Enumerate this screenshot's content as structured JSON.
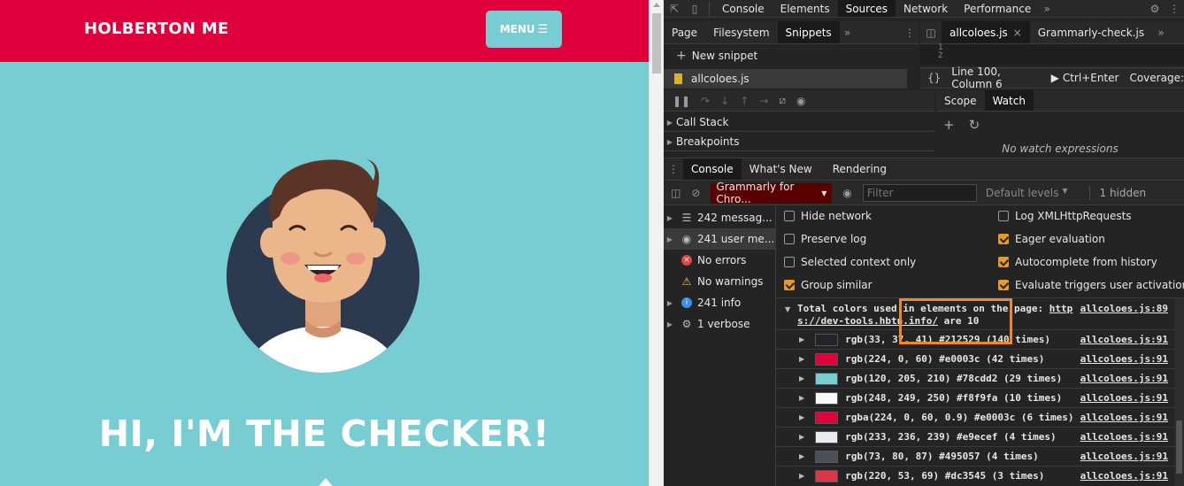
{
  "site": {
    "brand": "HOLBERTON ME",
    "menu_label": "MENU",
    "hero_text": "HI, I'M THE CHECKER!",
    "colors": {
      "primary": "#e0003c",
      "teal": "#78cdd2",
      "navy": "#2b3a4e"
    }
  },
  "devtools": {
    "main_tabs": [
      "Console",
      "Elements",
      "Sources",
      "Network",
      "Performance"
    ],
    "active_main_tab": "Sources",
    "nav_tabs": [
      "Page",
      "Filesystem",
      "Snippets"
    ],
    "new_snippet": "New snippet",
    "snippet_file": "allcoloes.js",
    "editor_tabs": [
      "allcoloes.js",
      "Grammarly-check.js"
    ],
    "line_numbers": [
      "1",
      "2"
    ],
    "status": {
      "position": "Line 100, Column 6",
      "run": "Ctrl+Enter",
      "coverage": "Coverage:"
    },
    "debug_sections": [
      "Call Stack",
      "Breakpoints"
    ],
    "scope_tabs": [
      "Scope",
      "Watch"
    ],
    "no_watch": "No watch expressions",
    "drawer_tabs": [
      "Console",
      "What's New",
      "Rendering"
    ],
    "context": "Grammarly for Chro...",
    "filter_placeholder": "Filter",
    "levels": "Default levels",
    "hidden": "1 hidden",
    "sidebar": [
      {
        "icon": "list-icon",
        "label": "242 messag..."
      },
      {
        "icon": "user-icon",
        "label": "241 user me..."
      },
      {
        "icon": "error-icon",
        "label": "No errors"
      },
      {
        "icon": "warning-icon",
        "label": "No warnings"
      },
      {
        "icon": "info-icon",
        "label": "241 info"
      },
      {
        "icon": "bug-icon",
        "label": "1 verbose"
      }
    ],
    "settings_left": [
      {
        "label": "Hide network",
        "checked": false
      },
      {
        "label": "Preserve log",
        "checked": false
      },
      {
        "label": "Selected context only",
        "checked": false
      },
      {
        "label": "Group similar",
        "checked": true
      }
    ],
    "settings_right": [
      {
        "label": "Log XMLHttpRequests",
        "checked": false
      },
      {
        "label": "Eager evaluation",
        "checked": true
      },
      {
        "label": "Autocomplete from history",
        "checked": true
      },
      {
        "label": "Evaluate triggers user activation",
        "checked": true
      }
    ],
    "summary": {
      "line1_pre": "Total colors used in elements on the page: ",
      "link_a": "http",
      "link_b": "s://dev-tools.hbtn.info/",
      "line2_post": " are 10",
      "source": "allcoloes.js:89"
    },
    "color_rows": [
      {
        "text": "rgb(33, 37, 41) #212529 (140 times)",
        "hex": "#212529",
        "source": "allcoloes.js:91"
      },
      {
        "text": "rgb(224, 0, 60) #e0003c (42 times)",
        "hex": "#e0003c",
        "source": "allcoloes.js:91"
      },
      {
        "text": "rgb(120, 205, 210) #78cdd2 (29 times)",
        "hex": "#78cdd2",
        "source": "allcoloes.js:91"
      },
      {
        "text": "rgb(248, 249, 250) #f8f9fa (10 times)",
        "hex": "#f8f9fa",
        "source": "allcoloes.js:91"
      },
      {
        "text": "rgba(224, 0, 60, 0.9) #e0003c (6 times)",
        "hex": "#e0003c",
        "source": "allcoloes.js:91"
      },
      {
        "text": "rgb(233, 236, 239) #e9ecef (4 times)",
        "hex": "#e9ecef",
        "source": "allcoloes.js:91"
      },
      {
        "text": "rgb(73, 80, 87) #495057 (4 times)",
        "hex": "#495057",
        "source": "allcoloes.js:91"
      },
      {
        "text": "rgb(220, 53, 69) #dc3545 (3 times)",
        "hex": "#dc3545",
        "source": "allcoloes.js:91"
      }
    ]
  }
}
